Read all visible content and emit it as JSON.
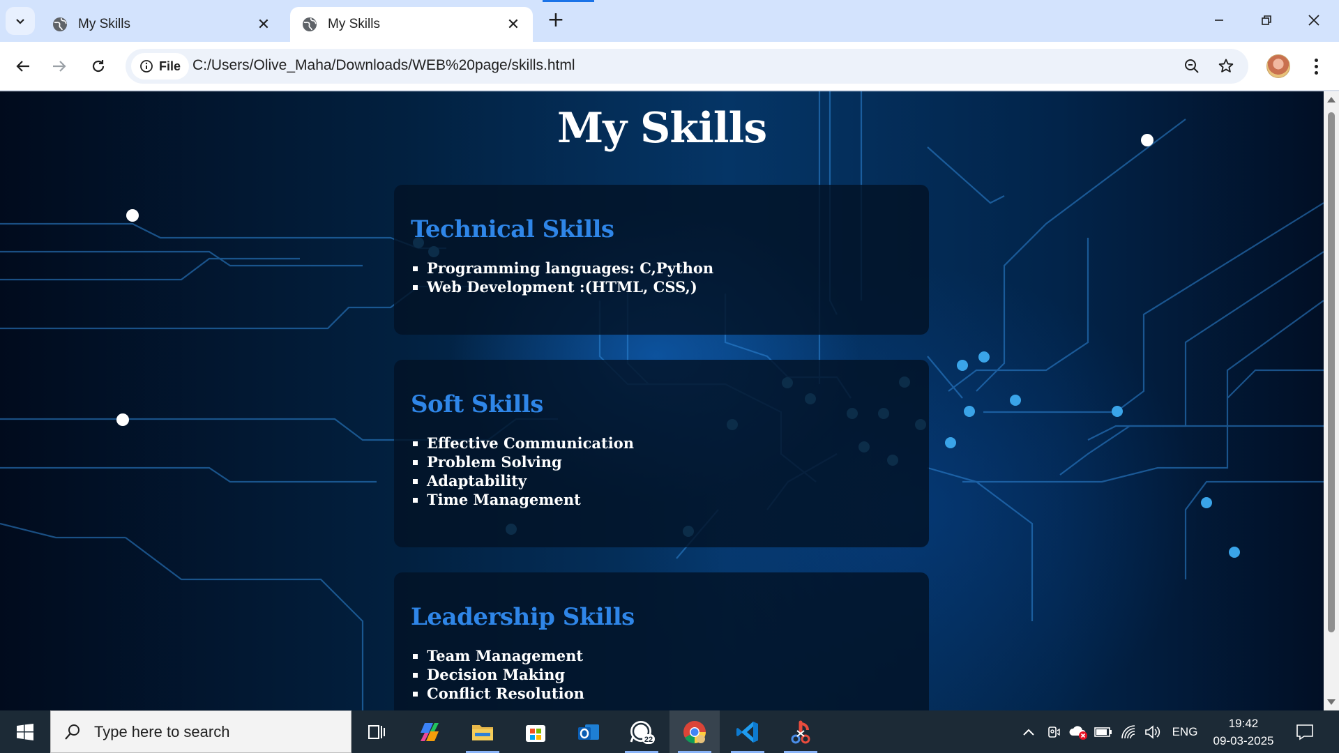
{
  "browser": {
    "tabs": [
      {
        "title": "My Skills",
        "active": false
      },
      {
        "title": "My Skills",
        "active": true
      }
    ],
    "site_chip_label": "File",
    "url": "C:/Users/Olive_Maha/Downloads/WEB%20page/skills.html"
  },
  "page": {
    "title": "My Skills",
    "sections": [
      {
        "heading": "Technical Skills",
        "items": [
          "Programming languages: C,Python",
          "Web Development :(HTML, CSS,)"
        ]
      },
      {
        "heading": "Soft Skills",
        "items": [
          "Effective Communication",
          "Problem Solving",
          "Adaptability",
          "Time Management"
        ]
      },
      {
        "heading": "Leadership Skills",
        "items": [
          "Team Management",
          "Decision Making",
          "Conflict Resolution"
        ]
      }
    ]
  },
  "taskbar": {
    "search_placeholder": "Type here to search",
    "apps": [
      "task-view-icon",
      "copilot-icon",
      "file-explorer-icon",
      "microsoft-store-icon",
      "outlook-icon",
      "whatsapp-icon",
      "chrome-icon",
      "vscode-icon",
      "snipping-tool-icon"
    ],
    "whatsapp_badge": "22",
    "language": "ENG",
    "time": "19:42",
    "date": "09-03-2025"
  },
  "colors": {
    "accent_heading": "#2f86e8",
    "page_bg": "#053566",
    "tab_strip": "#d3e3fd"
  }
}
